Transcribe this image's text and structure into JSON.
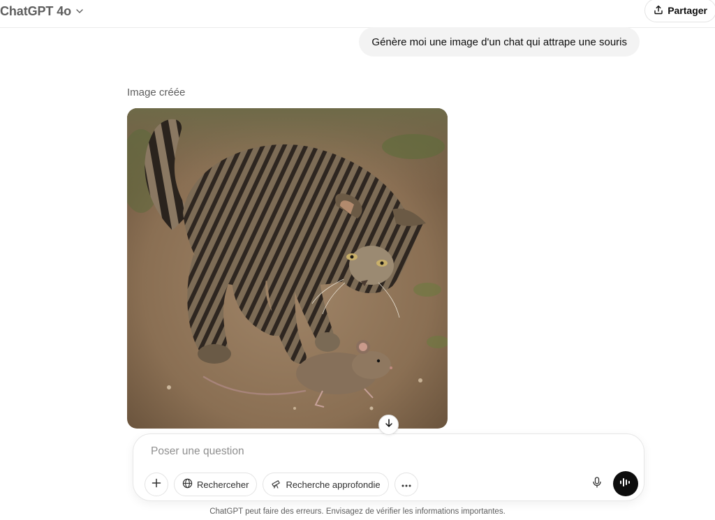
{
  "header": {
    "model_title": "ChatGPT 4o",
    "share_label": "Partager"
  },
  "conversation": {
    "user_message": "Génère moi une image d'un chat qui attrape une souris",
    "image_label": "Image créée",
    "image_icon": "generated-image-cat-catching-mouse"
  },
  "composer": {
    "placeholder": "Poser une question",
    "value": "",
    "search_label": "Recherceher",
    "deep_research_label": "Recherche approfondie"
  },
  "footer": {
    "disclaimer": "ChatGPT peut faire des erreurs. Envisagez de vérifier les informations importantes."
  },
  "colors": {
    "accent": "#0d0d0d",
    "bubble_bg": "#f3f3f3",
    "muted_text": "#5d5d5d"
  }
}
